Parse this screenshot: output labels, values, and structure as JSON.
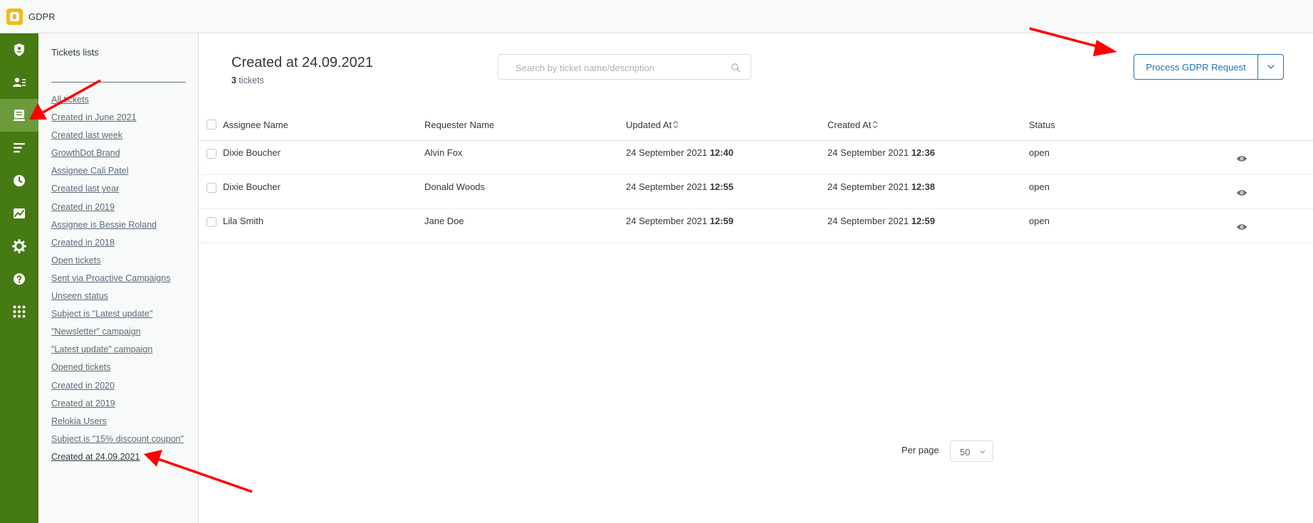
{
  "app": {
    "title": "GDPR",
    "logo_icon": "gdpr-shield-logo"
  },
  "rail": {
    "items": [
      {
        "name": "profile-shield",
        "icon": "user-shield-icon",
        "active": false
      },
      {
        "name": "contacts",
        "icon": "contact-card-icon",
        "active": false
      },
      {
        "name": "tickets",
        "icon": "ticket-inbox-icon",
        "active": true
      },
      {
        "name": "lists",
        "icon": "align-list-icon",
        "active": false
      },
      {
        "name": "history",
        "icon": "clock-icon",
        "active": false
      },
      {
        "name": "reports",
        "icon": "chart-icon",
        "active": false
      },
      {
        "name": "settings",
        "icon": "gear-icon",
        "active": false
      },
      {
        "name": "help",
        "icon": "help-icon",
        "active": false
      },
      {
        "name": "apps",
        "icon": "grid-dots-icon",
        "active": false
      }
    ],
    "bg_color": "#467a13",
    "active_color": "#6c9b3c"
  },
  "lists_panel": {
    "title": "Tickets lists",
    "items": [
      "All tickets",
      "Created in June 2021",
      "Created last week",
      "GrowthDot Brand",
      "Assignee Cali Patel",
      "Created last year",
      "Created in 2019",
      "Assignee is Bessie Roland",
      "Created in 2018",
      "Open tickets",
      "Sent via Proactive Campaigns",
      "Unseen status",
      "Subject is \"Latest update\"",
      "\"Newsletter\" campaign",
      "\"Latest update\" campaign",
      "Opened tickets",
      "Created in 2020",
      "Created at 2019",
      "Relokia Users",
      "Subject is \"15% discount coupon\"",
      "Created at 24.09.2021"
    ],
    "current": "Created at 24.09.2021"
  },
  "main": {
    "title": "Created at 24.09.2021",
    "count_number": "3",
    "count_suffix": " tickets",
    "search_placeholder": "Search by ticket name/description",
    "process_button": "Process GDPR Request"
  },
  "table": {
    "headers": {
      "assignee": "Assignee Name",
      "requester": "Requester Name",
      "updated": "Updated At",
      "created": "Created At",
      "status": "Status"
    },
    "rows": [
      {
        "assignee": "Dixie Boucher",
        "requester": "Alvin Fox",
        "updated_date": "24 September 2021",
        "updated_time": "12:40",
        "created_date": "24 September 2021",
        "created_time": "12:36",
        "status": "open"
      },
      {
        "assignee": "Dixie Boucher",
        "requester": "Donald Woods",
        "updated_date": "24 September 2021",
        "updated_time": "12:55",
        "created_date": "24 September 2021",
        "created_time": "12:38",
        "status": "open"
      },
      {
        "assignee": "Lila Smith",
        "requester": "Jane Doe",
        "updated_date": "24 September 2021",
        "updated_time": "12:59",
        "created_date": "24 September 2021",
        "created_time": "12:59",
        "status": "open"
      }
    ]
  },
  "pagination": {
    "per_page_label": "Per page",
    "per_page_value": "50"
  },
  "colors": {
    "accent_blue": "#1f73b7",
    "annotation_red": "#ff0000",
    "logo_yellow": "#f6b915"
  }
}
